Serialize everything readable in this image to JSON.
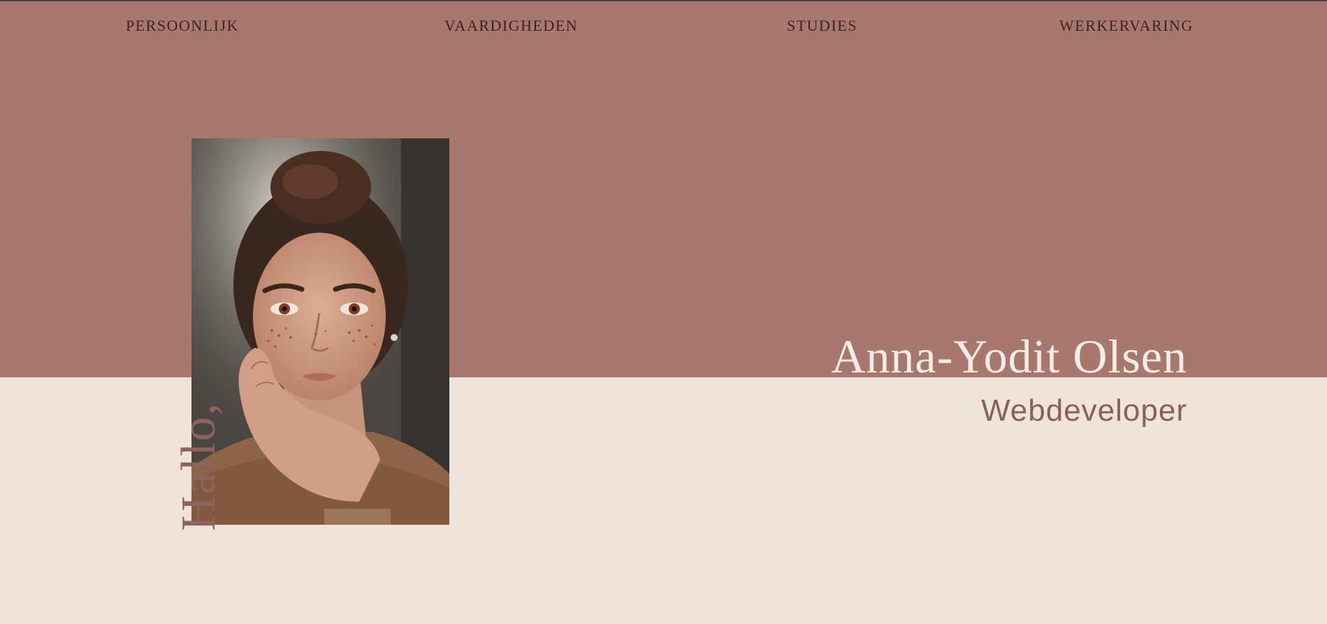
{
  "nav": {
    "items": [
      {
        "label": "PERSOONLIJK"
      },
      {
        "label": "VAARDIGHEDEN"
      },
      {
        "label": "STUDIES"
      },
      {
        "label": "WERKERVARING"
      }
    ]
  },
  "hero": {
    "greeting": "Hallo,",
    "name": "Anna-Yodit Olsen",
    "role": "Webdeveloper",
    "portrait_icon": "portrait-photo"
  },
  "colors": {
    "hero_top": "#a8786e",
    "hero_bottom": "#efe4dc",
    "nav_text": "#3b2420",
    "name_text": "#f6ede6",
    "accent_text": "#8b5f5a"
  }
}
